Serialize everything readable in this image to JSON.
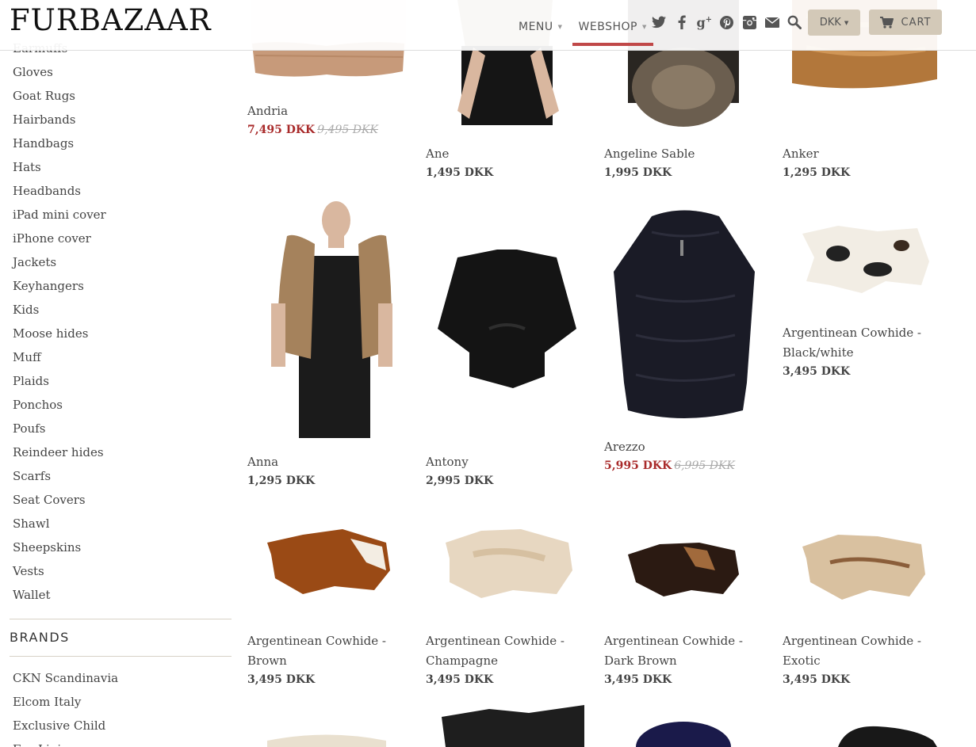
{
  "brand": {
    "logo_text": "FURBAZAAR"
  },
  "header": {
    "nav": [
      {
        "label": "MENU"
      },
      {
        "label": "WEBSHOP",
        "active": true
      }
    ],
    "social_icons": [
      "twitter-icon",
      "facebook-icon",
      "google-plus-icon",
      "pinterest-icon",
      "instagram-icon",
      "mail-icon",
      "search-icon"
    ],
    "currency": "DKK",
    "cart_label": "CART",
    "accent_color": "#c04848",
    "button_color": "#d3c9b8"
  },
  "sidebar": {
    "categories": [
      "Earmuffs",
      "Gloves",
      "Goat Rugs",
      "Hairbands",
      "Handbags",
      "Hats",
      "Headbands",
      "iPad mini cover",
      "iPhone cover",
      "Jackets",
      "Keyhangers",
      "Kids",
      "Moose hides",
      "Muff",
      "Plaids",
      "Ponchos",
      "Poufs",
      "Reindeer hides",
      "Scarfs",
      "Seat Covers",
      "Shawl",
      "Sheepskins",
      "Vests",
      "Wallet"
    ],
    "brands_title": "BRANDS",
    "brands": [
      "CKN Scandinavia",
      "Elcom Italy",
      "Exclusive Child",
      "Fur Lining"
    ]
  },
  "products": [
    {
      "name": "Andria",
      "price": "7,495 DKK",
      "old_price": "9,495 DKK",
      "sale": true,
      "image": "fur-coat"
    },
    {
      "name": "Ane",
      "price": "1,495 DKK",
      "image": "fur-vest-model"
    },
    {
      "name": "Angeline Sable",
      "price": "1,995 DKK",
      "image": "fur-collar"
    },
    {
      "name": "Anker",
      "price": "1,295 DKK",
      "image": "fur-pillow"
    },
    {
      "name": "Anna",
      "price": "1,295 DKK",
      "image": "fur-vest-model"
    },
    {
      "name": "Antony",
      "price": "2,995 DKK",
      "image": "fur-shrug"
    },
    {
      "name": "Arezzo",
      "price": "5,995 DKK",
      "old_price": "6,995 DKK",
      "sale": true,
      "image": "fur-vest"
    },
    {
      "name": "Argentinean Cowhide - Black/white",
      "price": "3,495 DKK",
      "image": "cowhide"
    },
    {
      "name": "Argentinean Cowhide - Brown",
      "price": "3,495 DKK",
      "image": "cowhide"
    },
    {
      "name": "Argentinean Cowhide - Champagne",
      "price": "3,495 DKK",
      "image": "cowhide"
    },
    {
      "name": "Argentinean Cowhide - Dark Brown",
      "price": "3,495 DKK",
      "image": "cowhide"
    },
    {
      "name": "Argentinean Cowhide - Exotic",
      "price": "3,495 DKK",
      "image": "cowhide"
    }
  ]
}
